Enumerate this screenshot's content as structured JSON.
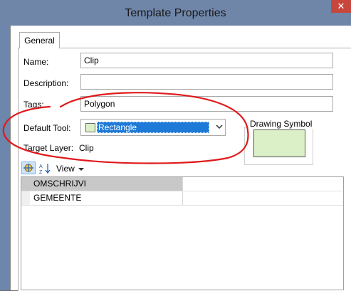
{
  "window": {
    "title": "Template Properties",
    "close_glyph": "✕"
  },
  "tabs": [
    {
      "label": "General",
      "active": true
    }
  ],
  "form": {
    "name_label": "Name:",
    "name_value": "Clip",
    "description_label": "Description:",
    "description_value": "",
    "tags_label": "Tags:",
    "tags_value": "Polygon",
    "default_tool_label": "Default Tool:",
    "default_tool_value": "Rectangle",
    "target_layer_label": "Target Layer:",
    "target_layer_value": "Clip"
  },
  "drawing_symbol": {
    "label": "Drawing Symbol",
    "fill_color": "#dcf0c8"
  },
  "toolbar": {
    "view_label": "View",
    "categorized_icon": "categorized-icon",
    "sort_icon": "sort-az-icon"
  },
  "attributes": [
    {
      "name": "OMSCHRIJVI",
      "value": ""
    },
    {
      "name": "GEMEENTE",
      "value": ""
    }
  ],
  "colors": {
    "title_bar": "#6f86a9",
    "close_button": "#c9463d",
    "selection": "#1e7ad6",
    "annotation": "#e0191b"
  }
}
